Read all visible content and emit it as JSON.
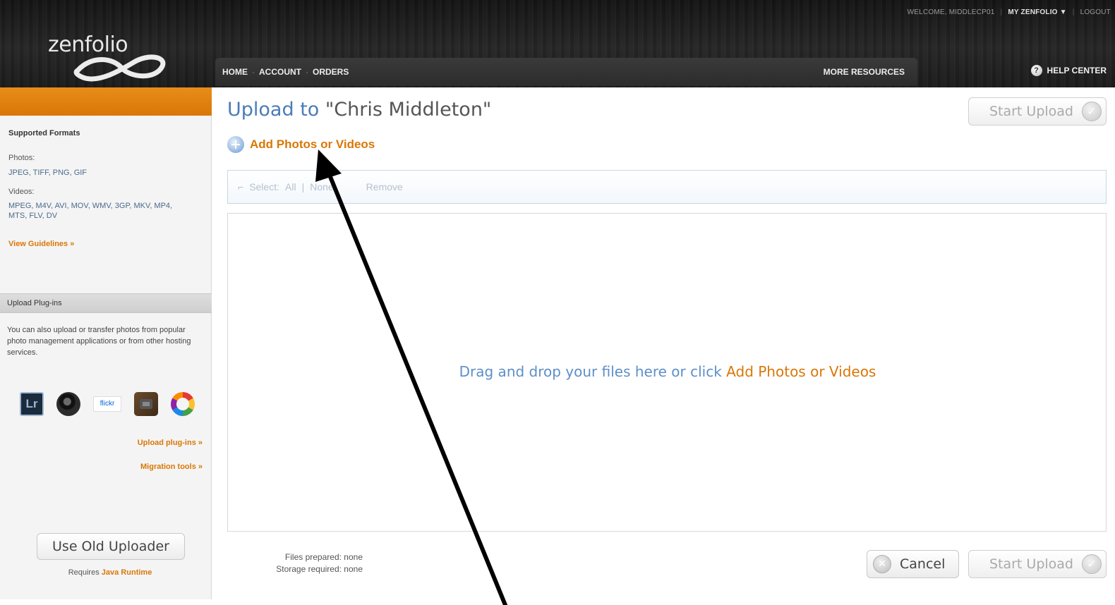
{
  "topbar": {
    "welcome": "WELCOME, MIDDLECP01",
    "my_zenfolio": "MY ZENFOLIO ▼",
    "logout": "LOGOUT"
  },
  "logo": {
    "text": "zenfolio"
  },
  "nav": {
    "home": "HOME",
    "account": "ACCOUNT",
    "orders": "ORDERS",
    "more_resources": "MORE RESOURCES",
    "help_center": "HELP CENTER"
  },
  "sidebar": {
    "supported_formats": "Supported Formats",
    "photos_label": "Photos:",
    "photos_formats": "JPEG, TIFF, PNG, GIF",
    "videos_label": "Videos:",
    "videos_formats": "MPEG, M4V, AVI, MOV, WMV, 3GP, MKV, MP4, MTS, FLV, DV",
    "view_guidelines": "View Guidelines »",
    "plugins_header": "Upload Plug-ins",
    "plugins_description": "You can also upload or transfer photos from popular photo management applications or from other hosting services.",
    "plugin_icons": [
      "lightroom-icon",
      "aperture-icon",
      "flickr-icon",
      "iphoto-icon",
      "picasa-icon"
    ],
    "flickr_text": "flickr",
    "lightroom_text": "Lr",
    "upload_plugins_link": "Upload plug-ins »",
    "migration_tools_link": "Migration tools »",
    "old_uploader_button": "Use Old Uploader",
    "requires_prefix": "Requires",
    "requires_link": "Java Runtime"
  },
  "main": {
    "title_prefix": "Upload to",
    "title_gallery": "\"Chris Middleton\"",
    "add_link": "Add Photos or Videos",
    "start_upload": "Start Upload",
    "toolbar": {
      "select_label": "Select:",
      "all": "All",
      "divider": "|",
      "none": "None",
      "remove": "Remove"
    },
    "drop_text_prefix": "Drag and drop your files here or click",
    "drop_text_link": "Add Photos or Videos",
    "files_prepared": "Files prepared: none",
    "storage_required": "Storage required: none",
    "cancel": "Cancel"
  },
  "colors": {
    "accent_orange": "#d97706",
    "link_blue": "#4a7cb8",
    "header_dark": "#1e1e1e"
  }
}
